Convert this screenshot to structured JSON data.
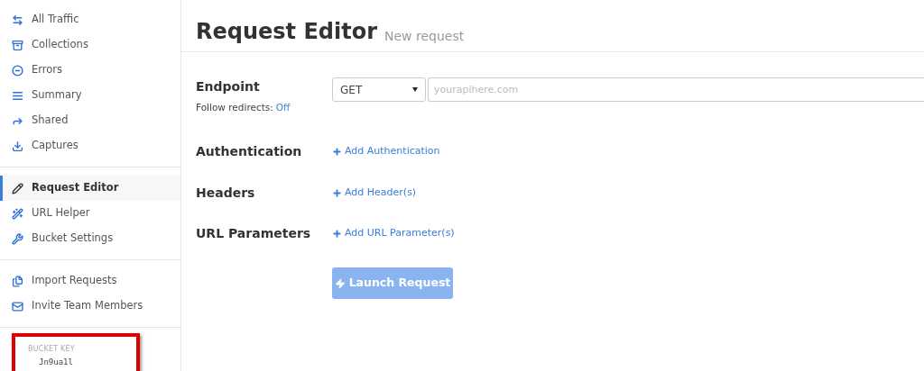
{
  "sidebar": {
    "groups": [
      {
        "items": [
          {
            "label": "All Traffic",
            "selected": false
          },
          {
            "label": "Collections",
            "selected": false
          },
          {
            "label": "Errors",
            "selected": false
          },
          {
            "label": "Summary",
            "selected": false
          },
          {
            "label": "Shared",
            "selected": false
          },
          {
            "label": "Captures",
            "selected": false
          }
        ]
      },
      {
        "items": [
          {
            "label": "Request Editor",
            "selected": true
          },
          {
            "label": "URL Helper",
            "selected": false
          },
          {
            "label": "Bucket Settings",
            "selected": false
          }
        ]
      },
      {
        "items": [
          {
            "label": "Import Requests",
            "selected": false
          },
          {
            "label": "Invite Team Members",
            "selected": false
          }
        ]
      }
    ],
    "bucket_key": {
      "label": "BUCKET KEY",
      "value": "Jn9ua1l",
      "highlighted": true
    }
  },
  "header": {
    "title": "Request Editor",
    "subtitle": "New request"
  },
  "endpoint": {
    "label": "Endpoint",
    "method": "GET",
    "url_placeholder": "yourapihere.com",
    "follow_redirects_label": "Follow redirects:",
    "follow_redirects_value": "Off"
  },
  "sections": [
    {
      "label": "Authentication",
      "action": "Add Authentication"
    },
    {
      "label": "Headers",
      "action": "Add Header(s)"
    },
    {
      "label": "URL Parameters",
      "action": "Add URL Parameter(s)"
    }
  ],
  "launch_button": {
    "label": "Launch Request",
    "disabled": true
  }
}
